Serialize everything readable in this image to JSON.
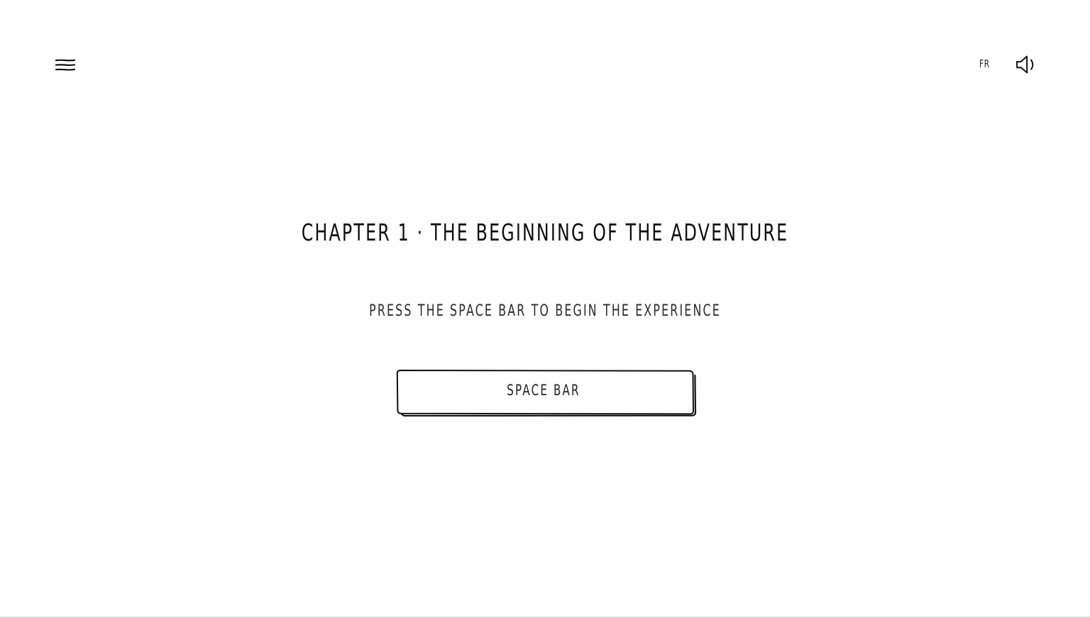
{
  "header": {
    "menu_icon": "hamburger-menu-icon",
    "language_label": "FR",
    "sound_icon": "speaker-sound-icon"
  },
  "main": {
    "chapter_title": "CHAPTER 1 · THE BEGINNING OF THE ADVENTURE",
    "instruction": "PRESS THE SPACE BAR TO BEGIN THE EXPERIENCE",
    "space_button_label": "SPACE BAR"
  },
  "colors": {
    "background": "#ffffff",
    "ink": "#111111"
  }
}
